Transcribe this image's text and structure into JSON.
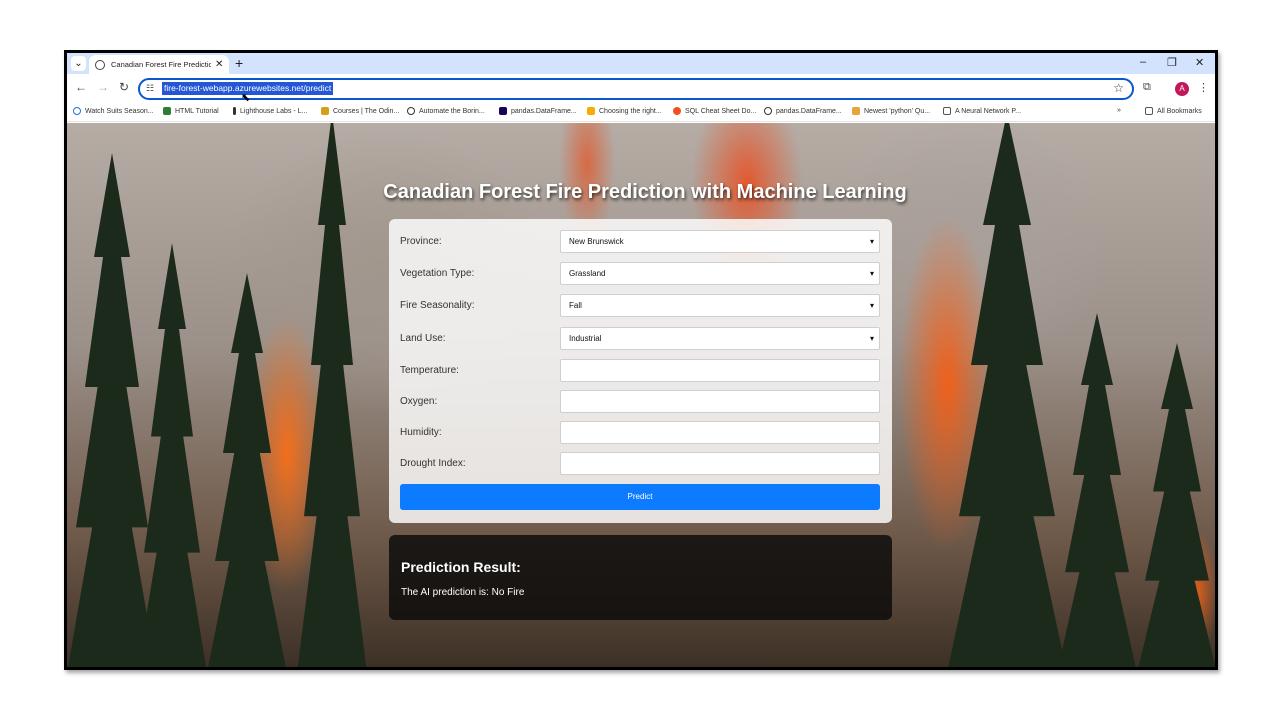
{
  "browser": {
    "tab_title": "Canadian Forest Fire Prediction",
    "url": "fire-forest-webapp.azurewebsites.net/predict",
    "avatar_letter": "A",
    "bookmarks": [
      "Watch Suits Season...",
      "HTML Tutorial",
      "Lighthouse Labs - L...",
      "Courses | The Odin...",
      "Automate the Borin...",
      "pandas.DataFrame...",
      "Choosing the right...",
      "SQL Cheat Sheet Do...",
      "pandas.DataFrame...",
      "Newest 'python' Qu...",
      "A Neural Network P..."
    ],
    "all_bookmarks": "All Bookmarks",
    "accent_color": "#0b57d0"
  },
  "page": {
    "title": "Canadian Forest Fire Prediction with Machine Learning",
    "form": {
      "fields": [
        {
          "label": "Province:",
          "value": "New Brunswick",
          "type": "select"
        },
        {
          "label": "Vegetation Type:",
          "value": "Grassland",
          "type": "select"
        },
        {
          "label": "Fire Seasonality:",
          "value": "Fall",
          "type": "select"
        },
        {
          "label": "Land Use:",
          "value": "Industrial",
          "type": "select"
        },
        {
          "label": "Temperature:",
          "value": "",
          "type": "input"
        },
        {
          "label": "Oxygen:",
          "value": "",
          "type": "input"
        },
        {
          "label": "Humidity:",
          "value": "",
          "type": "input"
        },
        {
          "label": "Drought Index:",
          "value": "",
          "type": "input"
        }
      ],
      "submit_label": "Predict",
      "button_color": "#0d7bff"
    },
    "result": {
      "heading": "Prediction Result:",
      "text": "The AI prediction is: No Fire"
    }
  }
}
